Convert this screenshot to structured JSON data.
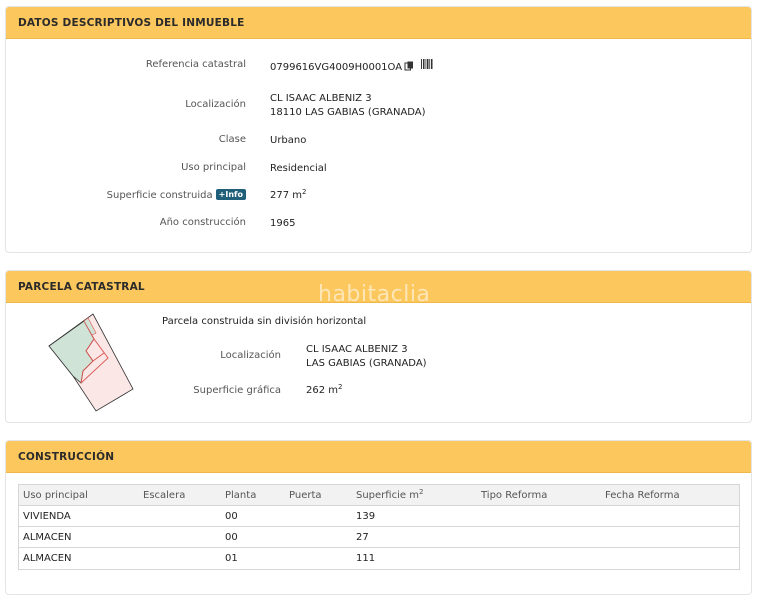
{
  "descriptivos": {
    "title": "DATOS DESCRIPTIVOS DEL INMUEBLE",
    "ref_label": "Referencia catastral",
    "ref_value": "0799616VG4009H0001OA",
    "loc_label": "Localización",
    "loc_line1": "CL ISAAC ALBENIZ 3",
    "loc_line2": "18110 LAS GABIAS (GRANADA)",
    "clase_label": "Clase",
    "clase_value": "Urbano",
    "uso_label": "Uso principal",
    "uso_value": "Residencial",
    "sup_label": "Superficie construida",
    "info_badge": "+Info",
    "sup_value": "277 m",
    "sup_exp": "2",
    "anio_label": "Año construcción",
    "anio_value": "1965"
  },
  "parcela": {
    "title": "PARCELA CATASTRAL",
    "watermark": "habitaclia",
    "subtitle": "Parcela construida sin división horizontal",
    "loc_label": "Localización",
    "loc_line1": "CL ISAAC ALBENIZ 3",
    "loc_line2": "LAS GABIAS (GRANADA)",
    "sup_label": "Superficie gráfica",
    "sup_value": "262 m",
    "sup_exp": "2"
  },
  "construccion": {
    "title": "CONSTRUCCIÓN",
    "headers": {
      "uso": "Uso principal",
      "escalera": "Escalera",
      "planta": "Planta",
      "puerta": "Puerta",
      "superficie": "Superficie m",
      "superficie_exp": "2",
      "tipo": "Tipo Reforma",
      "fecha": "Fecha Reforma"
    },
    "rows": [
      {
        "uso": "VIVIENDA",
        "escalera": "",
        "planta": "00",
        "puerta": "",
        "superficie": "139",
        "tipo": "",
        "fecha": ""
      },
      {
        "uso": "ALMACEN",
        "escalera": "",
        "planta": "00",
        "puerta": "",
        "superficie": "27",
        "tipo": "",
        "fecha": ""
      },
      {
        "uso": "ALMACEN",
        "escalera": "",
        "planta": "01",
        "puerta": "",
        "superficie": "111",
        "tipo": "",
        "fecha": ""
      }
    ]
  },
  "colors": {
    "header_bg": "#fcc75d",
    "badge_bg": "#1f5f7a",
    "parcel_green": "#cfe3d7",
    "parcel_pink": "#fbe7e6",
    "parcel_line": "#d9534f"
  }
}
